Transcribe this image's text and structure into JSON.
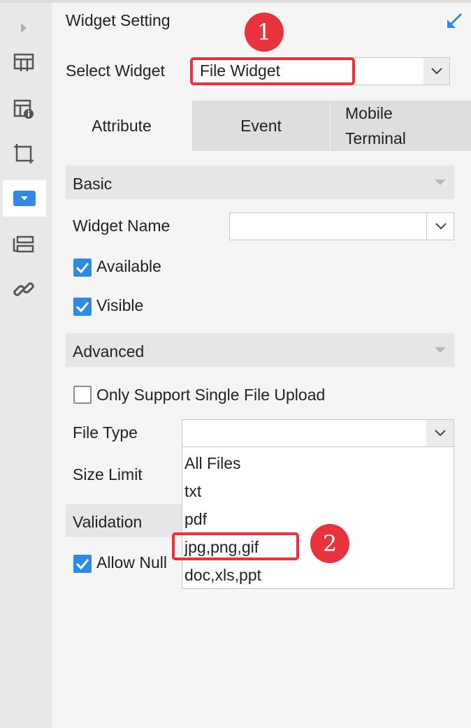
{
  "panel": {
    "title": "Widget Setting",
    "select_widget_label": "Select Widget",
    "select_widget_value": "File Widget"
  },
  "tabs": [
    {
      "label": "Attribute",
      "active": true
    },
    {
      "label": "Event",
      "active": false
    },
    {
      "label_line1": "Mobile",
      "label_line2": "Terminal",
      "active": false
    }
  ],
  "basic": {
    "title": "Basic",
    "widget_name_label": "Widget Name",
    "widget_name_value": "",
    "available_label": "Available",
    "available_checked": true,
    "visible_label": "Visible",
    "visible_checked": true
  },
  "advanced": {
    "title": "Advanced",
    "single_upload_label": "Only Support Single File Upload",
    "single_upload_checked": false,
    "file_type_label": "File Type",
    "file_type_value": "",
    "file_type_options": [
      "All Files",
      "txt",
      "pdf",
      "jpg,png,gif",
      "doc,xls,ppt"
    ],
    "size_limit_label": "Size Limit"
  },
  "validation": {
    "title": "Validation",
    "allow_null_label": "Allow Null",
    "allow_null_checked": true
  },
  "annotations": {
    "marker1": "1",
    "marker2": "2",
    "color": "#e8323c"
  },
  "colors": {
    "accent": "#2f8ae5",
    "sidebar_bg": "#e8e8e8",
    "panel_bg": "#f5f5f5"
  }
}
